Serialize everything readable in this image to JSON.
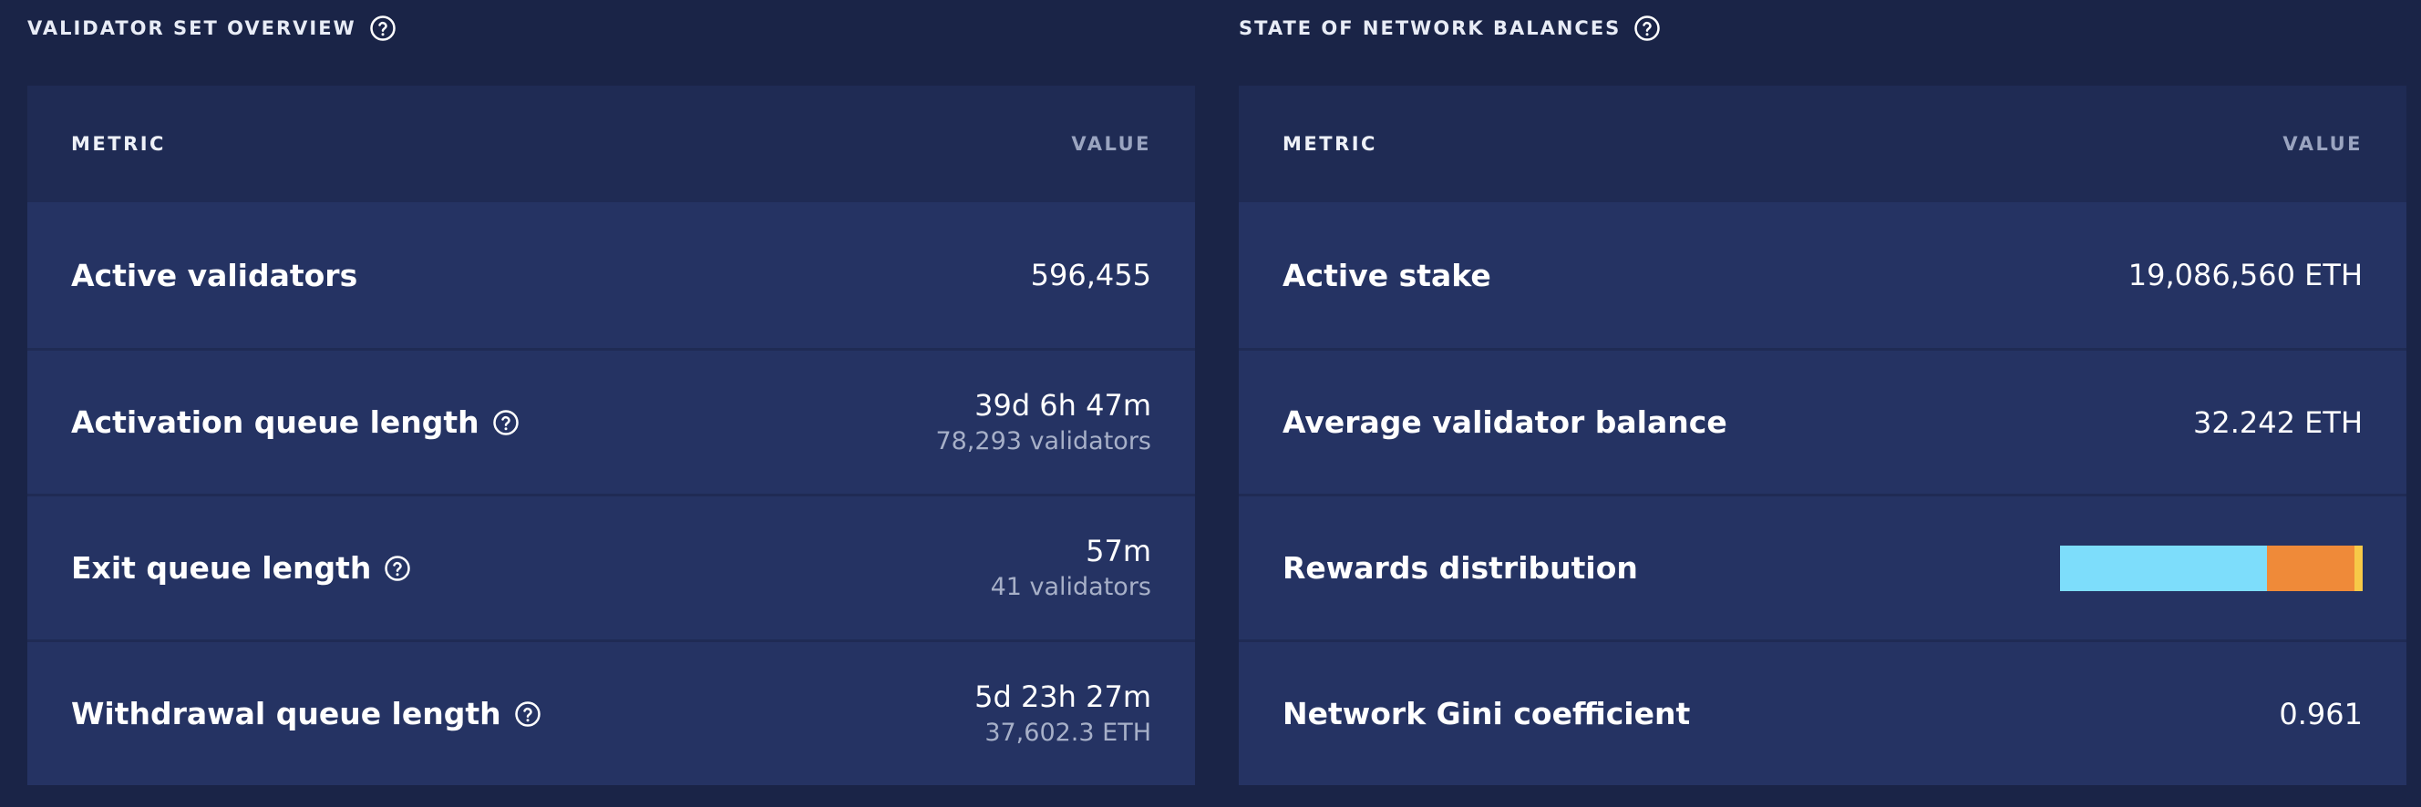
{
  "validator_set": {
    "title": "VALIDATOR SET OVERVIEW",
    "col_metric": "METRIC",
    "col_value": "VALUE",
    "rows": [
      {
        "label": "Active validators",
        "value": "596,455"
      },
      {
        "label": "Activation queue length",
        "value": "39d 6h 47m",
        "sub": "78,293 validators"
      },
      {
        "label": "Exit queue length",
        "value": "57m",
        "sub": "41 validators"
      },
      {
        "label": "Withdrawal queue length",
        "value": "5d 23h 27m",
        "sub": "37,602.3 ETH"
      }
    ]
  },
  "network_balances": {
    "title": "STATE OF NETWORK BALANCES",
    "col_metric": "METRIC",
    "col_value": "VALUE",
    "rows": [
      {
        "label": "Active stake",
        "value": "19,086,560 ETH"
      },
      {
        "label": "Average validator balance",
        "value": "32.242 ETH"
      },
      {
        "label": "Rewards distribution"
      },
      {
        "label": "Network Gini coefficient",
        "value": "0.961"
      }
    ],
    "rewards_distribution": [
      {
        "fraction": 0.683,
        "color": "#7dddfb"
      },
      {
        "fraction": 0.289,
        "color": "#ef8a39"
      },
      {
        "fraction": 0.028,
        "color": "#f7c948"
      }
    ]
  },
  "colors": {
    "background": "#1a2447",
    "card": "#253363",
    "card_header": "#1f2b54",
    "icon": "#ffffff"
  },
  "icons": {
    "help": "question-circle-icon"
  }
}
